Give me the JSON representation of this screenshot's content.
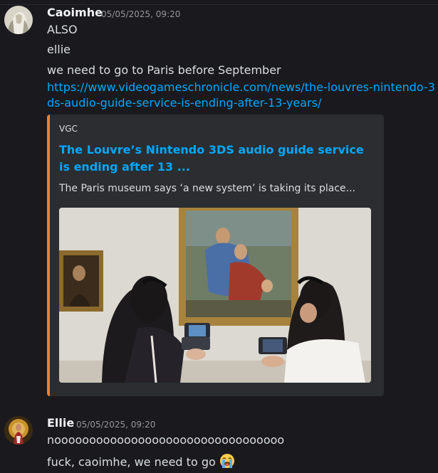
{
  "messages": [
    {
      "username": "Caoimhe",
      "timestamp": "05/05/2025, 09:20",
      "lines": [
        "ALSO",
        "ellie",
        "we need to go to Paris before September"
      ],
      "link": "https://www.videogameschronicle.com/news/the-louvres-nintendo-3ds-audio-guide-service-is-ending-after-13-years/",
      "embed": {
        "provider": "VGC",
        "title": "The Louvre’s Nintendo 3DS audio guide service is ending after 13 ...",
        "description": "The Paris museum says ‘a new system’ is taking its place...",
        "accent_color": "#f48024"
      }
    },
    {
      "username": "Ellie",
      "timestamp": "05/05/2025, 09:20",
      "lines": [
        "nooooooooooooooooooooooooooooooooo",
        "fuck, caoimhe, we need to go"
      ],
      "emoji": "sob-emoji"
    }
  ],
  "colors": {
    "background": "#1a1a1e",
    "link": "#00a8fc",
    "text": "#dbdee1",
    "muted": "#94959c"
  }
}
